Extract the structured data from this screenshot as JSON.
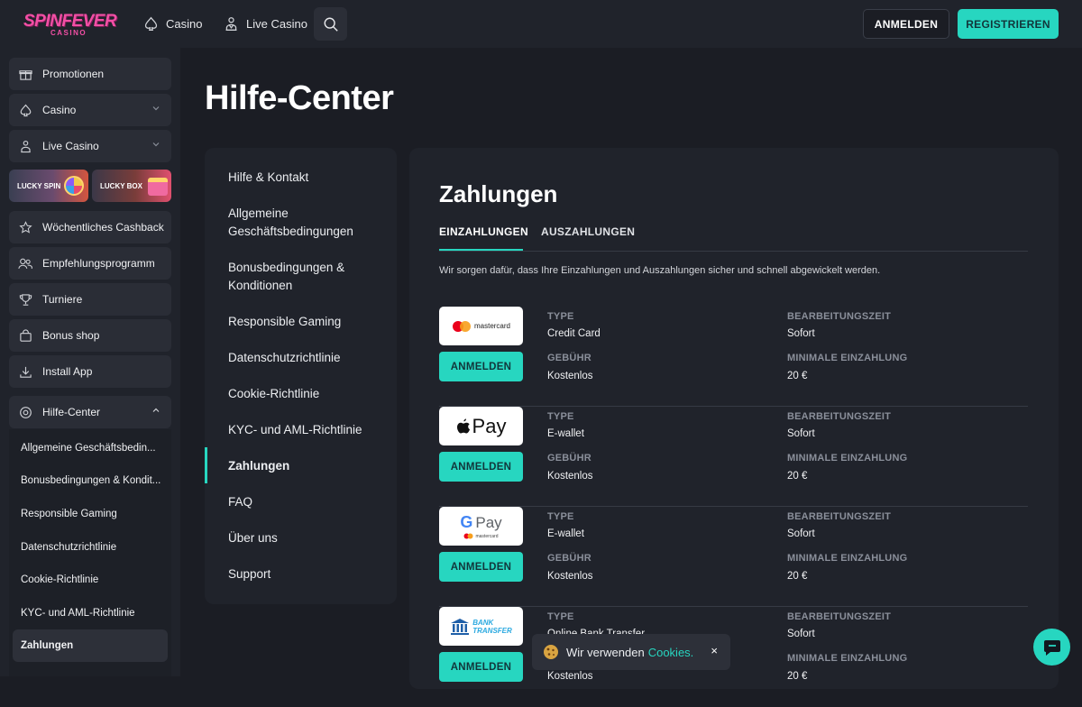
{
  "brand": {
    "logo_line1": "SPINFEVER",
    "logo_line2": "CASINO",
    "accent": "#27d6c0",
    "logo_color": "#f24fa5"
  },
  "header": {
    "nav": [
      {
        "label": "Casino",
        "icon": "spade-icon"
      },
      {
        "label": "Live Casino",
        "icon": "dealer-icon"
      }
    ],
    "search_icon": "search-icon",
    "login_label": "ANMELDEN",
    "register_label": "REGISTRIEREN"
  },
  "sidebar": {
    "items": [
      {
        "label": "Promotionen",
        "icon": "gift-icon"
      },
      {
        "label": "Casino",
        "icon": "spade-icon"
      },
      {
        "label": "Live Casino",
        "icon": "dealer-icon"
      },
      {
        "label": "Wöchentliches Cashback",
        "icon": "star-icon"
      },
      {
        "label": "Empfehlungsprogramm",
        "icon": "users-icon"
      },
      {
        "label": "Turniere",
        "icon": "trophy-icon"
      },
      {
        "label": "Bonus shop",
        "icon": "bag-icon"
      },
      {
        "label": "Install App",
        "icon": "download-icon"
      },
      {
        "label": "Hilfe-Center",
        "icon": "help-icon"
      }
    ],
    "promos": [
      "LUCKY SPIN",
      "LUCKY BOX"
    ],
    "help_sub": [
      "Allgemeine Geschäftsbedin...",
      "Bonusbedingungen & Kondit...",
      "Responsible Gaming",
      "Datenschutzrichtlinie",
      "Cookie-Richtlinie",
      "KYC- und AML-Richtlinie",
      "Zahlungen"
    ]
  },
  "page": {
    "title": "Hilfe-Center"
  },
  "help_nav": [
    {
      "line1": "Hilfe & Kontakt",
      "line2": ""
    },
    {
      "line1": "Allgemeine",
      "line2": "Geschäftsbedingungen"
    },
    {
      "line1": "Bonusbedingungen &",
      "line2": "Konditionen"
    },
    {
      "line1": "Responsible Gaming",
      "line2": ""
    },
    {
      "line1": "Datenschutzrichtlinie",
      "line2": ""
    },
    {
      "line1": "Cookie-Richtlinie",
      "line2": ""
    },
    {
      "line1": "KYC- und AML-Richtlinie",
      "line2": ""
    },
    {
      "line1": "Zahlungen",
      "line2": ""
    },
    {
      "line1": "FAQ",
      "line2": ""
    },
    {
      "line1": "Über uns",
      "line2": ""
    },
    {
      "line1": "Support",
      "line2": ""
    }
  ],
  "payments": {
    "title": "Zahlungen",
    "tabs": [
      "EINZAHLUNGEN",
      "AUSZAHLUNGEN"
    ],
    "description": "Wir sorgen dafür, dass Ihre Einzahlungen und Auszahlungen sicher und schnell abgewickelt werden.",
    "labels": {
      "type": "TYPE",
      "time": "BEARBEITUNGSZEIT",
      "fee": "GEBÜHR",
      "min": "MINIMALE EINZAHLUNG",
      "button": "ANMELDEN"
    },
    "methods": [
      {
        "name": "mastercard",
        "type": "Credit Card",
        "time": "Sofort",
        "fee": "Kostenlos",
        "min": "20 €"
      },
      {
        "name": "Pay",
        "type": "E-wallet",
        "time": "Sofort",
        "fee": "Kostenlos",
        "min": "20 €"
      },
      {
        "name": "Pay",
        "sub": "mastercard",
        "type": "E-wallet",
        "time": "Sofort",
        "fee": "Kostenlos",
        "min": "20 €"
      },
      {
        "name": "BANK",
        "sub": "TRANSFER",
        "type": "Online Bank Transfer",
        "time": "Sofort",
        "fee": "Kostenlos",
        "min": "20 €"
      }
    ]
  },
  "cookie": {
    "text": "Wir verwenden",
    "link": "Cookies.",
    "close": "×",
    "icon": "cookie-icon"
  },
  "chat": {
    "icon": "chat-icon"
  }
}
